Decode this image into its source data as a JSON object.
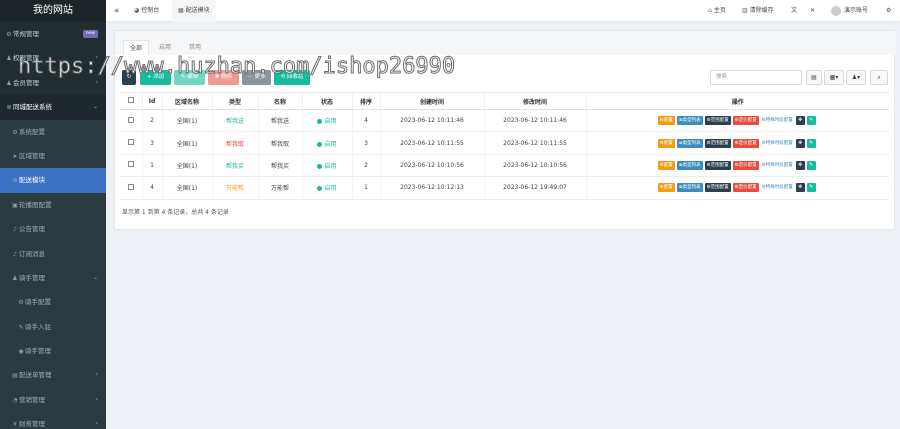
{
  "app": {
    "logo": "我的网站"
  },
  "sidebar": {
    "items": [
      {
        "label": "常规管理",
        "icon": "gears-icon",
        "badge": "new"
      },
      {
        "label": "权限管理",
        "icon": "group-icon",
        "chev": "‹"
      },
      {
        "label": "会员管理",
        "icon": "user-icon",
        "chev": "‹"
      },
      {
        "label": "同城配送系统",
        "icon": "list-icon",
        "chev": "⌄"
      },
      {
        "label": "系统配置",
        "icon": "gears-icon"
      },
      {
        "label": "区域管理",
        "icon": "location-icon"
      },
      {
        "label": "配送模块",
        "icon": "list-icon"
      },
      {
        "label": "轮播图配置",
        "icon": "image-icon"
      },
      {
        "label": "公告管理",
        "icon": "bell-icon"
      },
      {
        "label": "订阅消息",
        "icon": "bell-icon"
      },
      {
        "label": "骑手管理",
        "icon": "user-icon",
        "chev": "⌄"
      },
      {
        "label": "骑手配置",
        "icon": "gear-icon"
      },
      {
        "label": "骑手入驻",
        "icon": "edit-icon"
      },
      {
        "label": "骑手管理",
        "icon": "user-circle-icon"
      },
      {
        "label": "配送单管理",
        "icon": "file-icon",
        "chev": "‹"
      },
      {
        "label": "营销管理",
        "icon": "chart-icon",
        "chev": "‹"
      },
      {
        "label": "财务管理",
        "icon": "money-icon",
        "chev": "‹"
      }
    ]
  },
  "topbar": {
    "menu_icon": "≡",
    "tabs": [
      {
        "label": "控制台",
        "icon": "dashboard-icon"
      },
      {
        "label": "配送模块",
        "icon": "list-icon"
      }
    ],
    "home": "主页",
    "clear_cache": "清除缓存",
    "user": "演示账号"
  },
  "panel": {
    "tabs": [
      "全部",
      "启用",
      "禁用"
    ],
    "toolbar": {
      "refresh": "↻",
      "add": "+ 添加",
      "edit": "✎ 编辑",
      "delete": "✖ 删除",
      "more": "⋯ 更多",
      "recycle": "⟲ 回收站",
      "search_placeholder": "搜索"
    },
    "columns": [
      "Id",
      "区域名称",
      "类型",
      "名称",
      "状态",
      "排序",
      "创建时间",
      "修改时间",
      "操作"
    ],
    "rows": [
      {
        "id": "2",
        "region": "全国(1)",
        "type": "帮我送",
        "type_color": "#18bc9c",
        "name": "帮我送",
        "status": "启用",
        "sort": "4",
        "created": "2023-06-12 10:11:46",
        "modified": "2023-06-12 10:11:46"
      },
      {
        "id": "3",
        "region": "全国(1)",
        "type": "帮我取",
        "type_color": "#e74c3c",
        "name": "帮我取",
        "status": "启用",
        "sort": "3",
        "created": "2023-06-12 10:11:55",
        "modified": "2023-06-12 10:11:55"
      },
      {
        "id": "1",
        "region": "全国(1)",
        "type": "帮我买",
        "type_color": "#18bc9c",
        "name": "帮我买",
        "status": "启用",
        "sort": "2",
        "created": "2023-06-12 10:10:56",
        "modified": "2023-06-12 10:10:56"
      },
      {
        "id": "4",
        "region": "全国(1)",
        "type": "万能帮",
        "type_color": "#f39c12",
        "name": "万能帮",
        "status": "启用",
        "sort": "1",
        "created": "2023-06-12 10:12:13",
        "modified": "2023-06-12 19:49:07"
      }
    ],
    "ops": {
      "config": "配置",
      "type_list": "类型列表",
      "range": "范围配置",
      "price": "定价配置",
      "special": "特殊时段配置"
    },
    "footer": "显示第 1 到第 4 条记录，总共 4 条记录"
  },
  "watermark": "https://www.huzhan.com/ishop26990",
  "colors": {
    "sidebar_bg": "#222d32",
    "active": "#3c72c4",
    "orange": "#f39c12",
    "blue": "#3c8dbc",
    "dark": "#2c3e50",
    "red": "#e74c3c",
    "green": "#18bc9c"
  }
}
